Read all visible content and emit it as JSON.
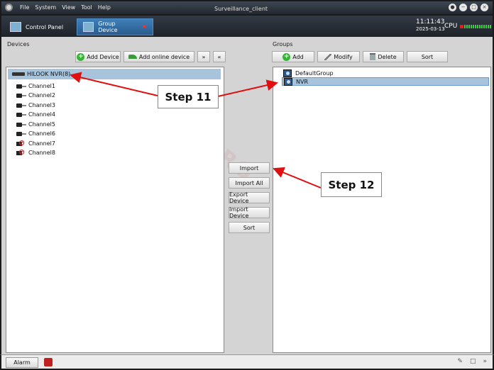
{
  "titlebar": {
    "menu": [
      "File",
      "System",
      "View",
      "Tool",
      "Help"
    ],
    "app_title": "Surveillance_client",
    "window_buttons": [
      "●",
      "−",
      "□",
      "×"
    ]
  },
  "tabs": [
    {
      "label": "Control Panel",
      "icon": "control-panel-icon",
      "active": false
    },
    {
      "label": "Group Device",
      "icon": "group-device-icon",
      "active": true,
      "close": "×"
    }
  ],
  "status_top": {
    "time": "11:11:43",
    "date": "2025-03-13",
    "cpu_label": "CPU"
  },
  "devices": {
    "label": "Devices",
    "buttons": {
      "add_device": "Add Device",
      "add_online_device": "Add online device",
      "expand": "»",
      "collapse": "«"
    },
    "root": "HILOOK NVR(8)",
    "channels": [
      {
        "name": "Channel1",
        "status": "online"
      },
      {
        "name": "Channel2",
        "status": "online"
      },
      {
        "name": "Channel3",
        "status": "online"
      },
      {
        "name": "Channel4",
        "status": "online"
      },
      {
        "name": "Channel5",
        "status": "online"
      },
      {
        "name": "Channel6",
        "status": "online"
      },
      {
        "name": "Channel7",
        "status": "offline"
      },
      {
        "name": "Channel8",
        "status": "offline"
      }
    ]
  },
  "groups": {
    "label": "Groups",
    "buttons": {
      "add": "Add",
      "modify": "Modify",
      "delete": "Delete",
      "sort": "Sort"
    },
    "items": [
      {
        "name": "DefaultGroup",
        "selected": false
      },
      {
        "name": "NVR",
        "selected": true
      }
    ]
  },
  "middle_buttons": {
    "import": "Import",
    "import_all": "Import All",
    "export_device": "Export Device",
    "import_device": "Import Device",
    "sort": "Sort"
  },
  "statusbar": {
    "alarm": "Alarm",
    "tray": [
      "✎",
      "□",
      "»"
    ]
  },
  "annotations": {
    "step11": "Step 11",
    "step12": "Step 12",
    "arrow_color": "#e01010"
  },
  "watermark": "XPRO SECURITY"
}
